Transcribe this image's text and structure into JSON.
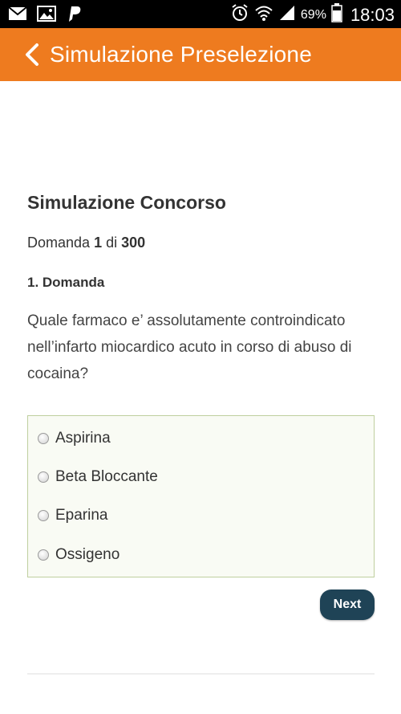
{
  "status_bar": {
    "icons_left": [
      "mail-icon",
      "image-icon",
      "paypal-icon"
    ],
    "icons_right": [
      "alarm-icon",
      "wifi-icon",
      "signal-icon",
      "battery-icon"
    ],
    "battery_percent": "69%",
    "time": "18:03"
  },
  "action_bar": {
    "title": "Simulazione Preselezione",
    "color": "#ee7b1f"
  },
  "quiz": {
    "title": "Simulazione Concorso",
    "counter_prefix": "Domanda",
    "current": "1",
    "counter_sep": "di",
    "total": "300",
    "question_heading": "1. Domanda",
    "question_text": "Quale farmaco e’ assolutamente controindicato nell’infarto miocardico acuto in corso di abuso di cocaina?",
    "options": [
      {
        "label": "Aspirina"
      },
      {
        "label": "Beta Bloccante"
      },
      {
        "label": "Eparina"
      },
      {
        "label": "Ossigeno"
      }
    ],
    "next_label": "Next"
  }
}
